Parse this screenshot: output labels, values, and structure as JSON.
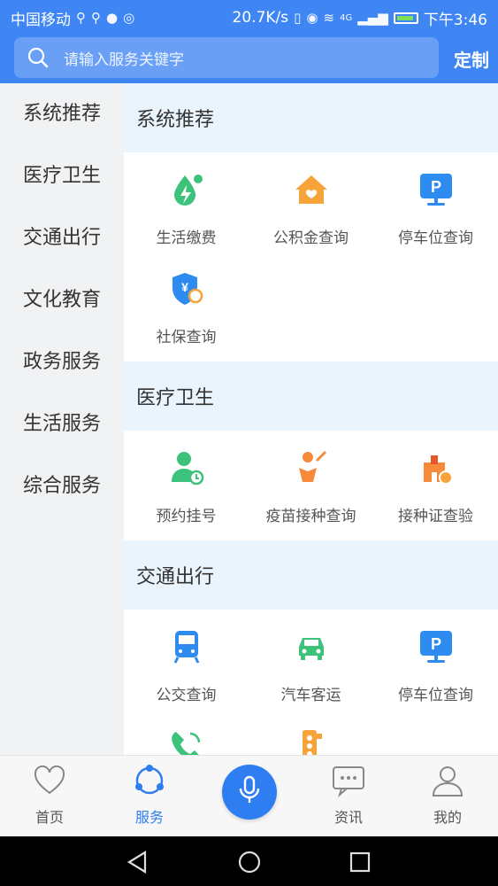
{
  "status": {
    "carrier": "中国移动",
    "speed": "20.7K/s",
    "time": "下午3:46",
    "net": "4G"
  },
  "search": {
    "placeholder": "请输入服务关键字",
    "custom_label": "定制"
  },
  "sidebar": {
    "items": [
      {
        "label": "系统推荐"
      },
      {
        "label": "医疗卫生"
      },
      {
        "label": "交通出行"
      },
      {
        "label": "文化教育"
      },
      {
        "label": "政务服务"
      },
      {
        "label": "生活服务"
      },
      {
        "label": "综合服务"
      }
    ]
  },
  "sections": [
    {
      "title": "系统推荐",
      "items": [
        {
          "label": "生活缴费",
          "icon": "bolt-drop-icon"
        },
        {
          "label": "公积金查询",
          "icon": "house-icon"
        },
        {
          "label": "停车位查询",
          "icon": "parking-icon"
        },
        {
          "label": "社保查询",
          "icon": "shield-yen-icon"
        }
      ]
    },
    {
      "title": "医疗卫生",
      "items": [
        {
          "label": "预约挂号",
          "icon": "nurse-icon"
        },
        {
          "label": "疫苗接种查询",
          "icon": "vaccine-icon"
        },
        {
          "label": "接种证查验",
          "icon": "hospital-icon"
        }
      ]
    },
    {
      "title": "交通出行",
      "items": [
        {
          "label": "公交查询",
          "icon": "bus-icon"
        },
        {
          "label": "汽车客运",
          "icon": "car-icon"
        },
        {
          "label": "停车位查询",
          "icon": "parking-icon"
        },
        {
          "label": "",
          "icon": "phone-icon"
        },
        {
          "label": "",
          "icon": "traffic-light-icon"
        }
      ]
    }
  ],
  "tabs": [
    {
      "label": "首页",
      "icon": "heart-icon"
    },
    {
      "label": "服务",
      "icon": "share-nodes-icon"
    },
    {
      "label": "资讯",
      "icon": "chat-icon"
    },
    {
      "label": "我的",
      "icon": "user-icon"
    }
  ],
  "colors": {
    "primary": "#3f86f4",
    "active": "#2e7ef2",
    "section_bg": "#eaf4fd",
    "sidebar_bg": "#f1f2f4"
  }
}
